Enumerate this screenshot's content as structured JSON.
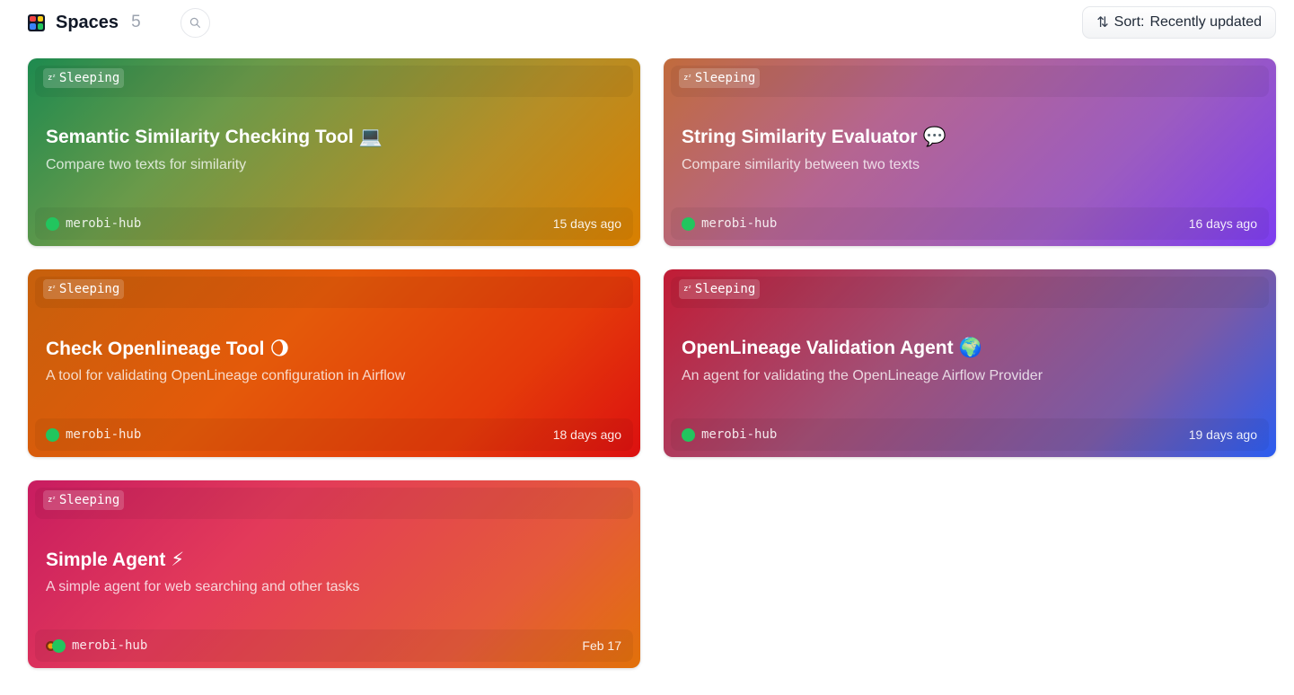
{
  "header": {
    "title": "Spaces",
    "count": "5",
    "sort_prefix": "Sort:",
    "sort_value": "Recently updated"
  },
  "cards": [
    {
      "status": "Sleeping",
      "title": "Semantic Similarity Checking Tool",
      "emoji": "💻",
      "description": "Compare two texts for similarity",
      "author": "merobi-hub",
      "updated": "15 days ago"
    },
    {
      "status": "Sleeping",
      "title": "String Similarity Evaluator",
      "emoji": "💬",
      "description": "Compare similarity between two texts",
      "author": "merobi-hub",
      "updated": "16 days ago"
    },
    {
      "status": "Sleeping",
      "title": "Check Openlineage Tool",
      "emoji": "🌖",
      "description": "A tool for validating OpenLineage configuration in Airflow",
      "author": "merobi-hub",
      "updated": "18 days ago"
    },
    {
      "status": "Sleeping",
      "title": "OpenLineage Validation Agent",
      "emoji": "🌍",
      "description": "An agent for validating the OpenLineage Airflow Provider",
      "author": "merobi-hub",
      "updated": "19 days ago"
    },
    {
      "status": "Sleeping",
      "title": "Simple Agent",
      "emoji": "⚡",
      "description": "A simple agent for web searching and other tasks",
      "author": "merobi-hub",
      "updated": "Feb 17"
    }
  ],
  "icons": {
    "spaces": "spaces-grid-icon",
    "search": "search-icon",
    "sort": "sort-arrows-icon",
    "sleeping": "zz-sleep-icon"
  },
  "colors": {
    "avatar_status": "#22c55e"
  }
}
